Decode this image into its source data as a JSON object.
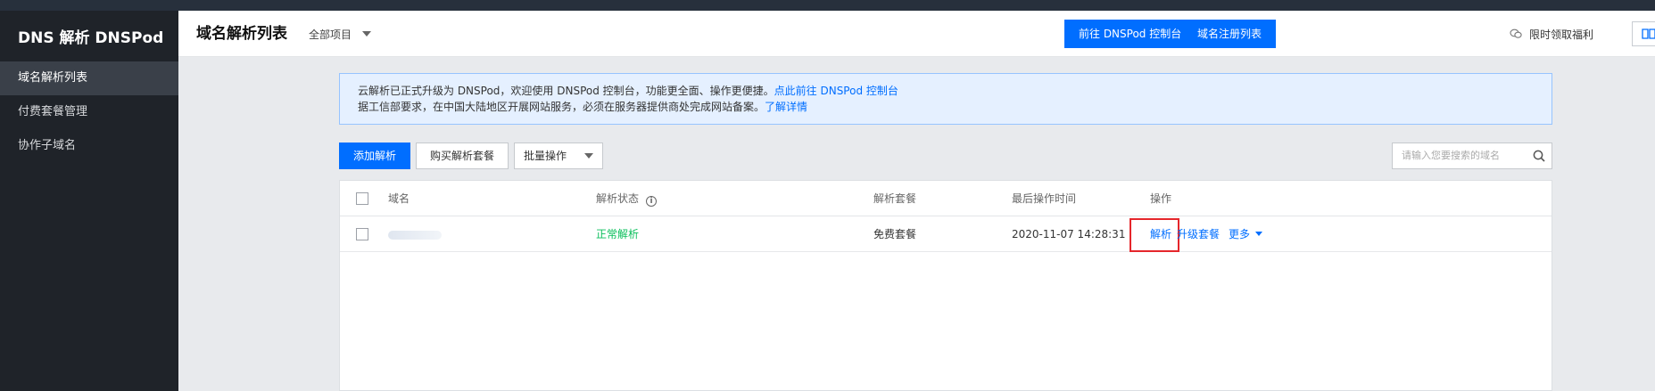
{
  "sidebar": {
    "brand": "DNS 解析 DNSPod",
    "items": [
      {
        "label": "域名解析列表",
        "active": true
      },
      {
        "label": "付费套餐管理",
        "active": false
      },
      {
        "label": "协作子域名",
        "active": false
      }
    ]
  },
  "header": {
    "title": "域名解析列表",
    "project": "全部项目",
    "console_button": "前往 DNSPod 控制台",
    "register_button": "域名注册列表",
    "welfare": "限时领取福利"
  },
  "notice": {
    "line1_text": "云解析已正式升级为 DNSPod，欢迎使用 DNSPod 控制台，功能更全面、操作更便捷。",
    "line1_link": "点此前往 DNSPod 控制台",
    "line2_text": "据工信部要求，在中国大陆地区开展网站服务，必须在服务器提供商处完成网站备案。",
    "line2_link": "了解详情"
  },
  "toolbar": {
    "add": "添加解析",
    "buy": "购买解析套餐",
    "batch": "批量操作",
    "search_placeholder": "请输入您要搜索的域名"
  },
  "table": {
    "columns": {
      "domain": "域名",
      "status": "解析状态",
      "package": "解析套餐",
      "last_op": "最后操作时间",
      "actions": "操作"
    },
    "rows": [
      {
        "status": "正常解析",
        "package": "免费套餐",
        "last_op": "2020-11-07 14:28:31",
        "action_resolve": "解析",
        "action_upgrade": "升级套餐",
        "action_more": "更多"
      }
    ]
  },
  "colors": {
    "primary": "#006eff",
    "status_ok": "#0abf5b",
    "highlight": "#e5262b",
    "sidebar_bg": "#1f2329"
  }
}
